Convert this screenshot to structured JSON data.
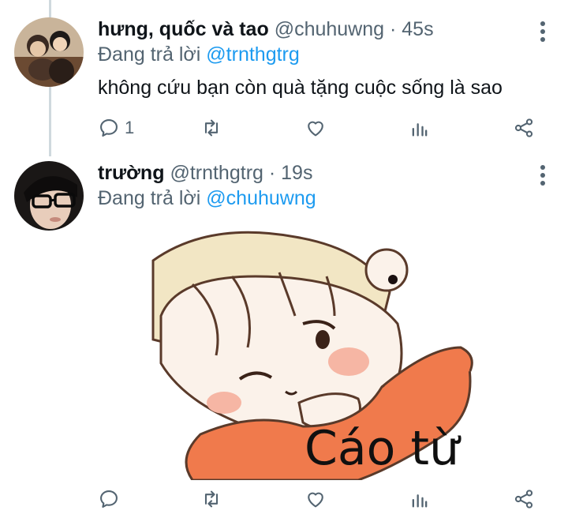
{
  "tweets": [
    {
      "name": "hưng, quốc và tao",
      "handle": "@chuhuwng",
      "dot": "·",
      "time": "45s",
      "replying_prefix": "Đang trả lời",
      "replying_to": "@trnthgtrg",
      "text": "không cứu bạn còn quà tặng cuộc sống là sao",
      "reply_count": "1"
    },
    {
      "name": "trường",
      "handle": "@trnthgtrg",
      "dot": "·",
      "time": "19s",
      "replying_prefix": "Đang trả lời",
      "replying_to": "@chuhuwng",
      "media_caption": "Cáo từ"
    }
  ],
  "icons": [
    "reply-icon",
    "retweet-icon",
    "like-icon",
    "analytics-icon",
    "share-icon",
    "more-options-icon"
  ],
  "colors": {
    "link": "#1d9bf0",
    "muted": "#536471",
    "text": "#0f1419"
  }
}
